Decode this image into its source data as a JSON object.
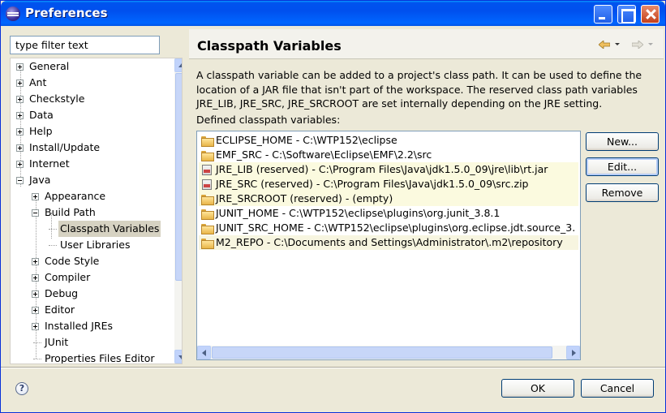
{
  "window": {
    "title": "Preferences"
  },
  "filter": {
    "placeholder": "type filter text",
    "value": "type filter text"
  },
  "tree": {
    "items": [
      {
        "label": "General",
        "level": 0,
        "expander": "plus"
      },
      {
        "label": "Ant",
        "level": 0,
        "expander": "plus"
      },
      {
        "label": "Checkstyle",
        "level": 0,
        "expander": "plus"
      },
      {
        "label": "Data",
        "level": 0,
        "expander": "plus"
      },
      {
        "label": "Help",
        "level": 0,
        "expander": "plus"
      },
      {
        "label": "Install/Update",
        "level": 0,
        "expander": "plus"
      },
      {
        "label": "Internet",
        "level": 0,
        "expander": "plus"
      },
      {
        "label": "Java",
        "level": 0,
        "expander": "minus"
      },
      {
        "label": "Appearance",
        "level": 1,
        "expander": "plus"
      },
      {
        "label": "Build Path",
        "level": 1,
        "expander": "minus"
      },
      {
        "label": "Classpath Variables",
        "level": 2,
        "expander": "none",
        "selected": true
      },
      {
        "label": "User Libraries",
        "level": 2,
        "expander": "none"
      },
      {
        "label": "Code Style",
        "level": 1,
        "expander": "plus"
      },
      {
        "label": "Compiler",
        "level": 1,
        "expander": "plus"
      },
      {
        "label": "Debug",
        "level": 1,
        "expander": "plus"
      },
      {
        "label": "Editor",
        "level": 1,
        "expander": "plus"
      },
      {
        "label": "Installed JREs",
        "level": 1,
        "expander": "plus"
      },
      {
        "label": "JUnit",
        "level": 1,
        "expander": "none"
      },
      {
        "label": "Properties Files Editor",
        "level": 1,
        "expander": "none"
      }
    ]
  },
  "page": {
    "title": "Classpath Variables",
    "description": "A classpath variable can be added to a project's class path. It can be used to define the location of a JAR file that isn't part of the workspace. The reserved class path variables JRE_LIB, JRE_SRC, JRE_SRCROOT are set internally depending on the JRE setting.",
    "defined_label": "Defined classpath variables:",
    "variables": [
      {
        "text": "ECLIPSE_HOME - C:\\WTP152\\eclipse",
        "icon": "folder-icon",
        "reserved": false
      },
      {
        "text": "EMF_SRC - C:\\Software\\Eclipse\\EMF\\2.2\\src",
        "icon": "folder-icon",
        "reserved": false
      },
      {
        "text": "JRE_LIB (reserved) - C:\\Program Files\\Java\\jdk1.5.0_09\\jre\\lib\\rt.jar",
        "icon": "jar-icon",
        "reserved": true
      },
      {
        "text": "JRE_SRC (reserved) - C:\\Program Files\\Java\\jdk1.5.0_09\\src.zip",
        "icon": "jar-icon",
        "reserved": true
      },
      {
        "text": "JRE_SRCROOT (reserved) - (empty)",
        "icon": "folder-icon",
        "reserved": true
      },
      {
        "text": "JUNIT_HOME - C:\\WTP152\\eclipse\\plugins\\org.junit_3.8.1",
        "icon": "folder-icon",
        "reserved": false
      },
      {
        "text": "JUNIT_SRC_HOME - C:\\WTP152\\eclipse\\plugins\\org.eclipse.jdt.source_3.",
        "icon": "folder-icon",
        "reserved": false
      },
      {
        "text": "M2_REPO - C:\\Documents and Settings\\Administrator\\.m2\\repository",
        "icon": "folder-icon",
        "reserved": false,
        "highlighted": true
      }
    ],
    "buttons": {
      "new": "New...",
      "edit": "Edit...",
      "remove": "Remove"
    }
  },
  "footer": {
    "help_icon": "?",
    "ok": "OK",
    "cancel": "Cancel"
  },
  "colors": {
    "titlebar": "#0053ee",
    "window_bg": "#ece9d8",
    "button_border": "#003c74"
  }
}
